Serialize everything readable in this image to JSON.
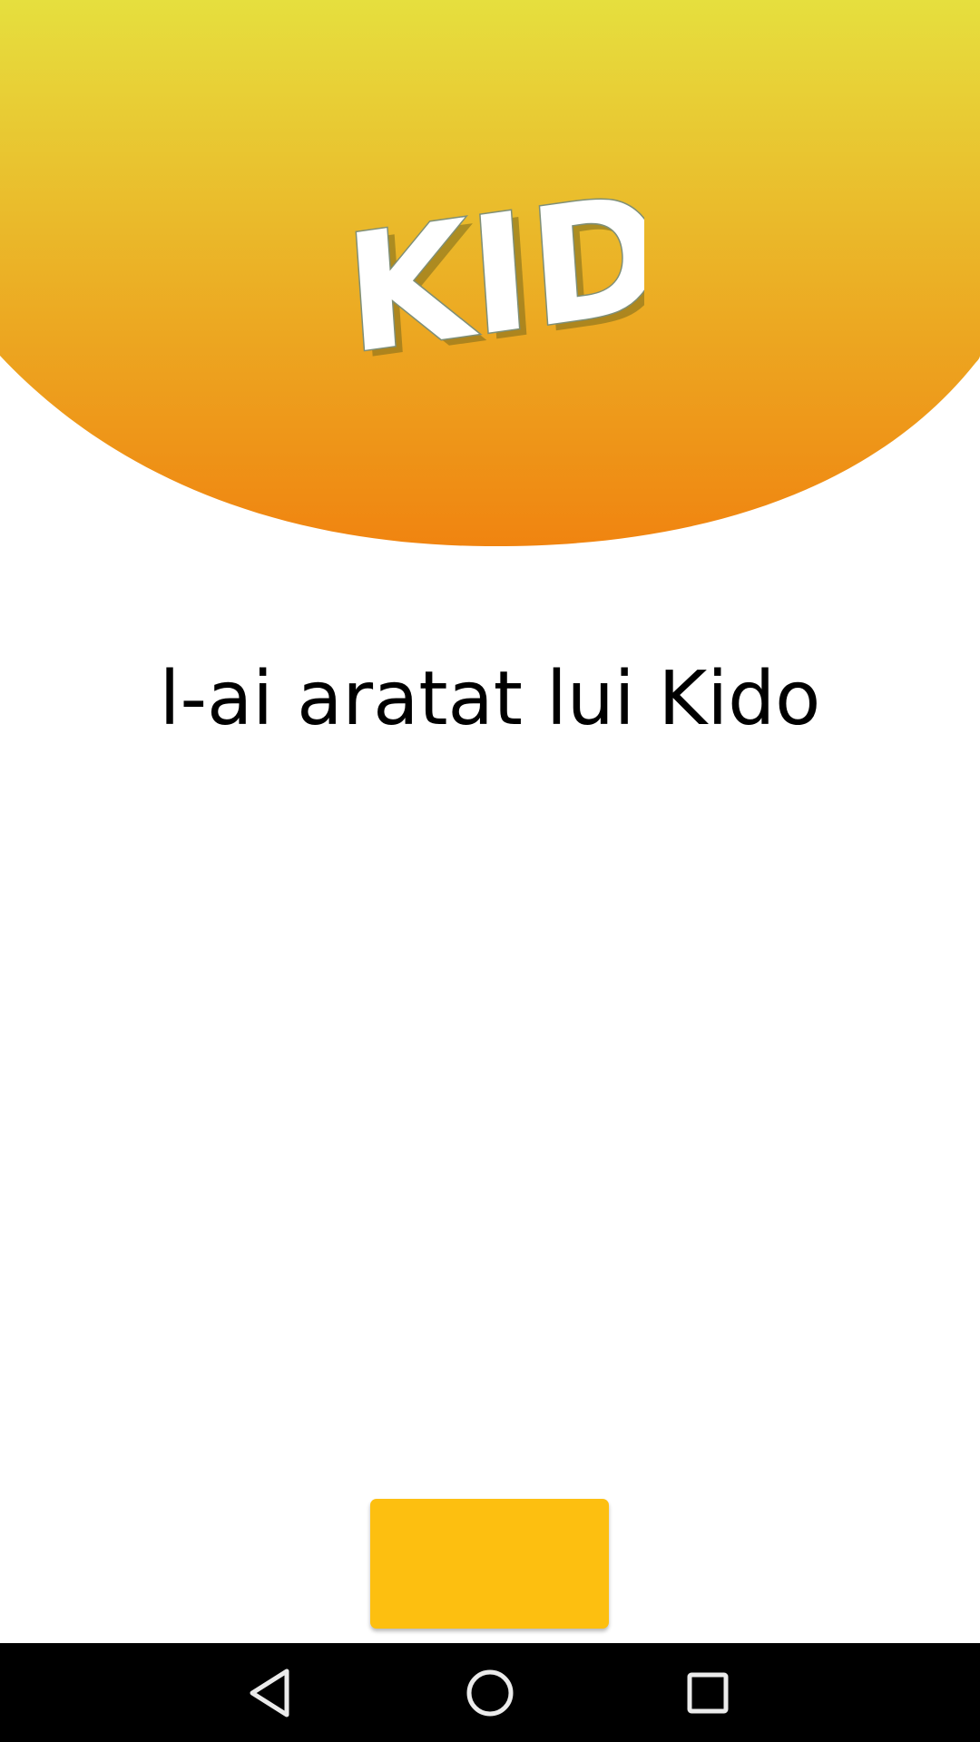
{
  "app": {
    "logo_text": "KIDO",
    "message": "l-ai aratat lui Kido",
    "action_button_label": ""
  },
  "colors": {
    "header_gradient_top": "#e6df3e",
    "header_gradient_bottom": "#f08410",
    "button": "#fdbf10",
    "nav_bar": "#000000"
  },
  "navigation": {
    "back_icon": "triangle-back-icon",
    "home_icon": "circle-home-icon",
    "recents_icon": "square-recents-icon"
  }
}
